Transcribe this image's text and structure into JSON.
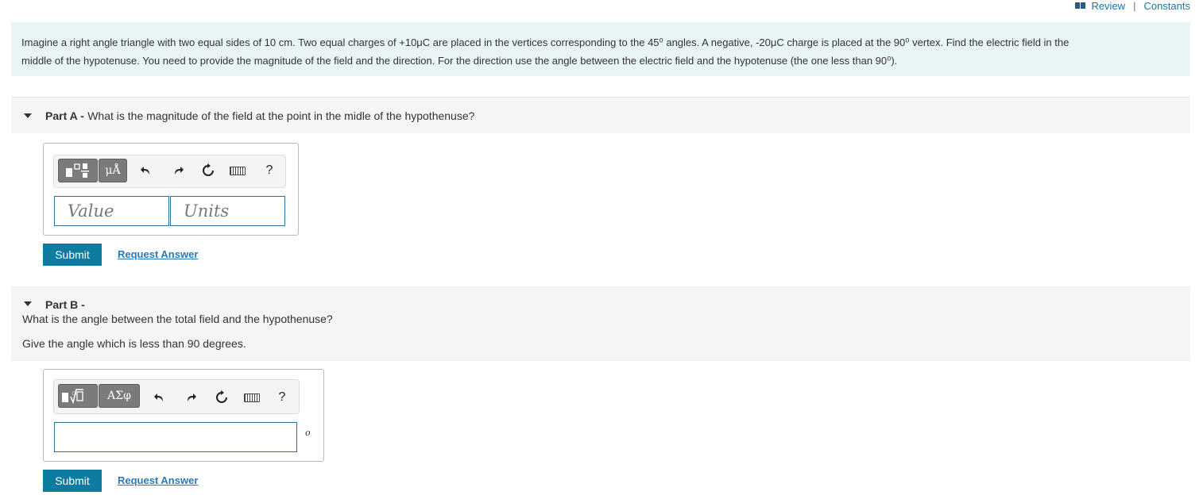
{
  "topbar": {
    "review": "Review",
    "constants": "Constants"
  },
  "intro": {
    "line1": "Imagine a right angle triangle with two equal sides of 10 cm.  Two equal charges of +10μC are placed in the vertices corresponding to the 45⁰ angles. A negative, -20μC charge is placed at the 90⁰ vertex. Find the electric field in the",
    "line2": "middle of the hypotenuse.   You need  to provide the magnitude of the field and the direction. For the direction use the angle between the electric field and the hypotenuse (the one less than 90⁰)."
  },
  "partA": {
    "label": "Part A -",
    "question": "What is the magnitude of the field at the point in the midle of the hypothenuse?",
    "toolbar": {
      "templates_icon": "templates-icon",
      "units_label": "μÅ",
      "undo_icon": "undo-icon",
      "redo_icon": "redo-icon",
      "reset_icon": "reset-icon",
      "keyboard_icon": "keyboard-icon",
      "help": "?"
    },
    "value_placeholder": "Value",
    "units_placeholder": "Units",
    "submit": "Submit",
    "request": "Request Answer"
  },
  "partB": {
    "label": "Part B -",
    "question": "What is the angle between the total field and the hypothenuse?",
    "instruction": "Give the angle which is less than 90 degrees.",
    "toolbar": {
      "templates_icon": "templates-icon",
      "greek_label": "ΑΣφ",
      "undo_icon": "undo-icon",
      "redo_icon": "redo-icon",
      "reset_icon": "reset-icon",
      "keyboard_icon": "keyboard-icon",
      "help": "?"
    },
    "answer_value": "",
    "unit_symbol": "o",
    "submit": "Submit",
    "request": "Request Answer"
  },
  "colors": {
    "accent": "#0e7ca0",
    "link": "#2a7ab8",
    "intro_bg": "#e9f5f4",
    "part_bg": "#f5f5f5",
    "field_border": "#2a6f97"
  }
}
